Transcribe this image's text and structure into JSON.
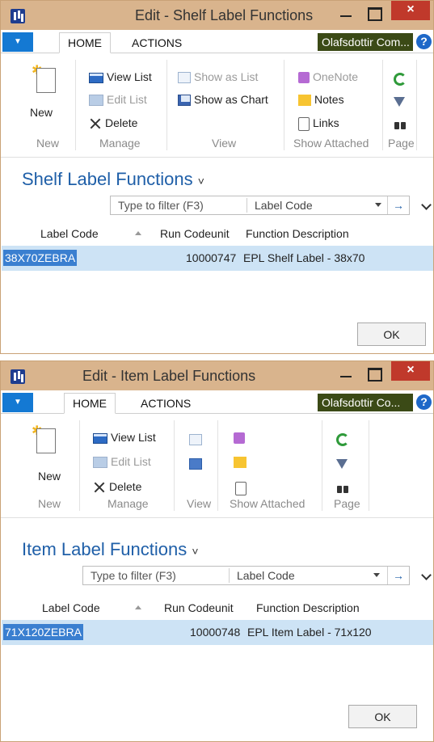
{
  "windows": [
    {
      "title": "Edit - Shelf Label Functions",
      "close_glyph": "×",
      "file_glyph": "▼",
      "tabs": [
        "HOME",
        "ACTIONS"
      ],
      "company": "Olafsdottir Com...",
      "help_glyph": "?",
      "ribbon": {
        "new_label": "New",
        "view_list": "View List",
        "edit_list": "Edit List",
        "delete": "Delete",
        "show_as_list": "Show as List",
        "show_as_chart": "Show as Chart",
        "onenote": "OneNote",
        "notes": "Notes",
        "links": "Links",
        "groups": [
          "New",
          "Manage",
          "View",
          "Show Attached",
          "Page"
        ]
      },
      "page_title": "Shelf Label Functions",
      "title_caret": "˅",
      "filter": {
        "placeholder": "Type to filter (F3)",
        "field": "Label Code",
        "go_glyph": "→"
      },
      "columns": [
        "Label Code",
        "Run Codeunit",
        "Function Description"
      ],
      "rows": [
        {
          "code": "38X70ZEBRA",
          "codeunit": "10000747",
          "description": "EPL Shelf Label - 38x70"
        }
      ],
      "ok": "OK"
    },
    {
      "title": "Edit - Item Label Functions",
      "close_glyph": "×",
      "file_glyph": "▼",
      "tabs": [
        "HOME",
        "ACTIONS"
      ],
      "company": "Olafsdottir Co...",
      "help_glyph": "?",
      "ribbon": {
        "new_label": "New",
        "view_list": "View List",
        "edit_list": "Edit List",
        "delete": "Delete",
        "groups": [
          "New",
          "Manage",
          "View",
          "Show Attached",
          "Page"
        ]
      },
      "page_title": "Item Label Functions",
      "title_caret": "˅",
      "filter": {
        "placeholder": "Type to filter (F3)",
        "field": "Label Code",
        "go_glyph": "→"
      },
      "columns": [
        "Label Code",
        "Run Codeunit",
        "Function Description"
      ],
      "rows": [
        {
          "code": "71X120ZEBRA",
          "codeunit": "10000748",
          "description": "EPL Item Label - 71x120"
        }
      ],
      "ok": "OK"
    }
  ],
  "colors": {
    "titlebar": "#d9b48d",
    "accent": "#1479d3",
    "company_bg": "#3b4a16",
    "selection": "#cde3f5",
    "close": "#c0392b",
    "page_title": "#1f5fa8"
  }
}
